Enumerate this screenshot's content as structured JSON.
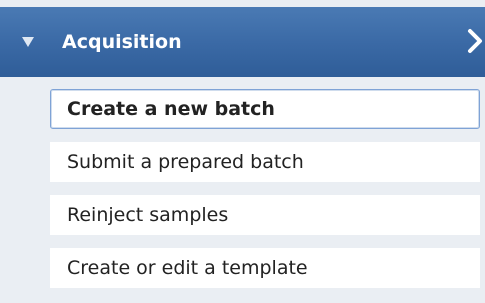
{
  "header": {
    "title": "Acquisition",
    "expanded_icon": "triangle-down-icon",
    "nav_icon": "chevron-right-icon"
  },
  "menu": {
    "items": [
      {
        "label": "Create a new batch",
        "selected": true
      },
      {
        "label": "Submit a prepared batch",
        "selected": false
      },
      {
        "label": "Reinject samples",
        "selected": false
      },
      {
        "label": "Create or edit a template",
        "selected": false
      }
    ]
  },
  "colors": {
    "header": "#3b6aa6",
    "panel_bg": "#eaeef3",
    "selected_border": "#7fa3d6"
  }
}
